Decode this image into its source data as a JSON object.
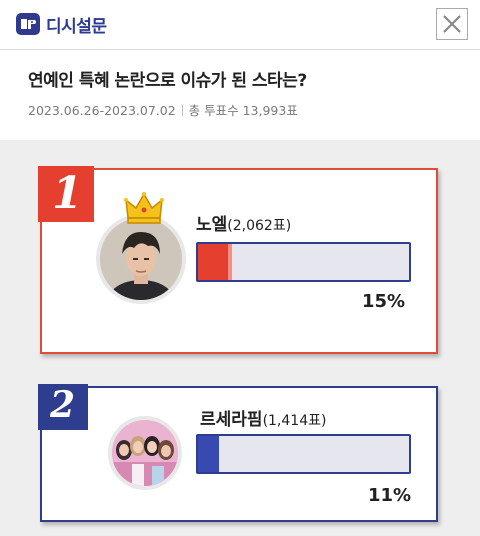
{
  "header": {
    "brand": "디시설문",
    "logo_icon": "dc-logo-icon",
    "close_icon": "close-icon"
  },
  "poll": {
    "title": "연예인 특혜 논란으로 이슈가 된 스타는?",
    "period": "2023.06.26-2023.07.02",
    "total_votes": "총 투표수 13,993표"
  },
  "results": [
    {
      "rank": "1",
      "name": "노엘",
      "votes": "(2,062표)",
      "percent_label": "15%",
      "percent": 0.15,
      "color": "#e5402f",
      "badge": "crown-icon"
    },
    {
      "rank": "2",
      "name": "르세라핌",
      "votes": "(1,414표)",
      "percent_label": "11%",
      "percent": 0.11,
      "color": "#3849b0"
    }
  ],
  "colors": {
    "accent_red": "#e5402f",
    "accent_navy": "#2e3d8e",
    "background": "#eeeeee"
  }
}
